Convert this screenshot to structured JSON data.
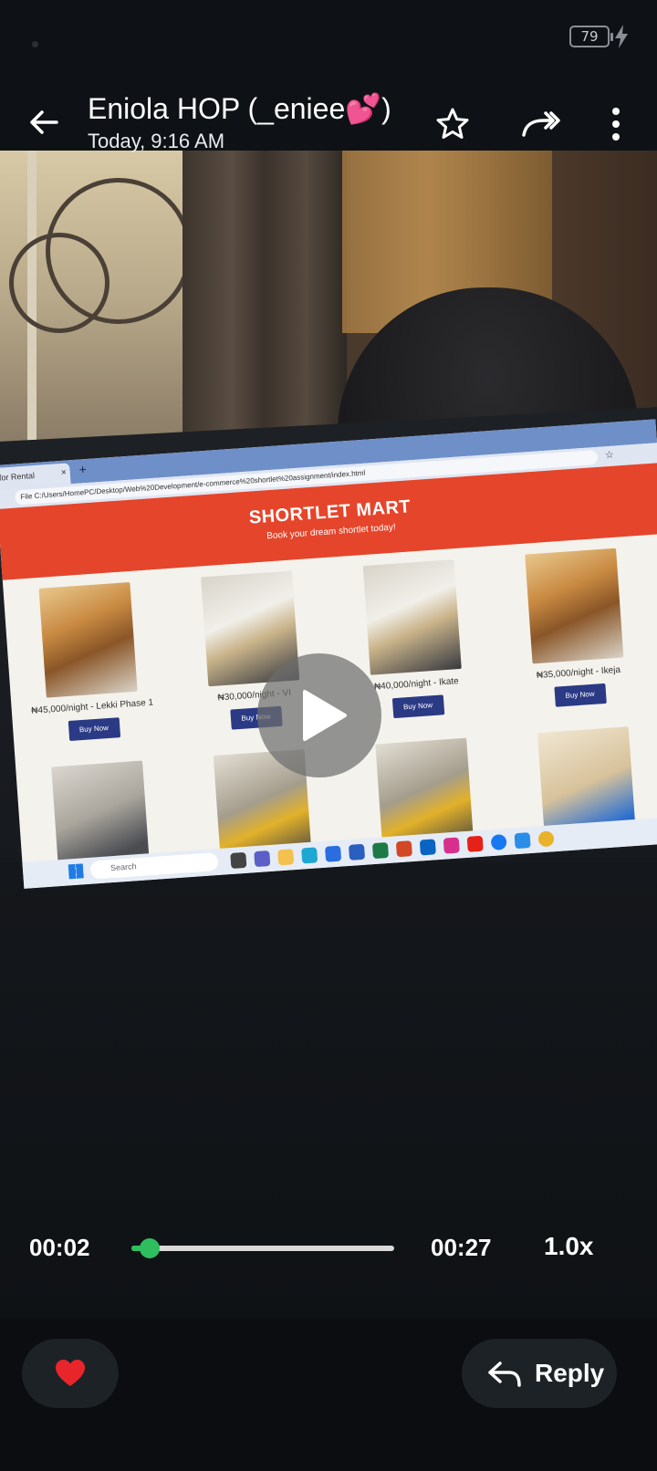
{
  "status_bar": {
    "battery": "79",
    "icons": [
      "camera-dot",
      "battery-icon",
      "charging-bolt-icon"
    ]
  },
  "header": {
    "title": "Eniola HOP (_eniee💕)",
    "subtitle": "Today, 9:16 AM",
    "icons": [
      "back-arrow-icon",
      "star-icon",
      "forward-icon",
      "more-vertical-icon"
    ]
  },
  "media": {
    "browser": {
      "tab_title": "for Rental",
      "tab_close": "×",
      "new_tab": "+",
      "address": "C:/Users/HomePC/Desktop/Web%20Development/e-commerce%20shortlet%20assignment/index.html",
      "address_prefix": "File"
    },
    "site": {
      "brand": "SHORTLET MART",
      "tagline": "Book your dream shortlet today!",
      "listings": [
        {
          "price": "₦45,000/night - Lekki Phase 1",
          "button": "Buy Now"
        },
        {
          "price": "₦30,000/night - VI",
          "button": "Buy Now"
        },
        {
          "price": "₦40,000/night - Ikate",
          "button": "Buy Now"
        },
        {
          "price": "₦35,000/night - Ikeja",
          "button": "Buy Now"
        }
      ]
    },
    "taskbar": {
      "search_placeholder": "Search"
    }
  },
  "player": {
    "current_time": "00:02",
    "total_time": "00:27",
    "progress": 0.07,
    "speed": "1.0x",
    "accent_color": "#2fbe5f"
  },
  "actions": {
    "react_icon": "heart-icon",
    "reply_label": "Reply",
    "reply_icon": "reply-arrow-icon"
  }
}
